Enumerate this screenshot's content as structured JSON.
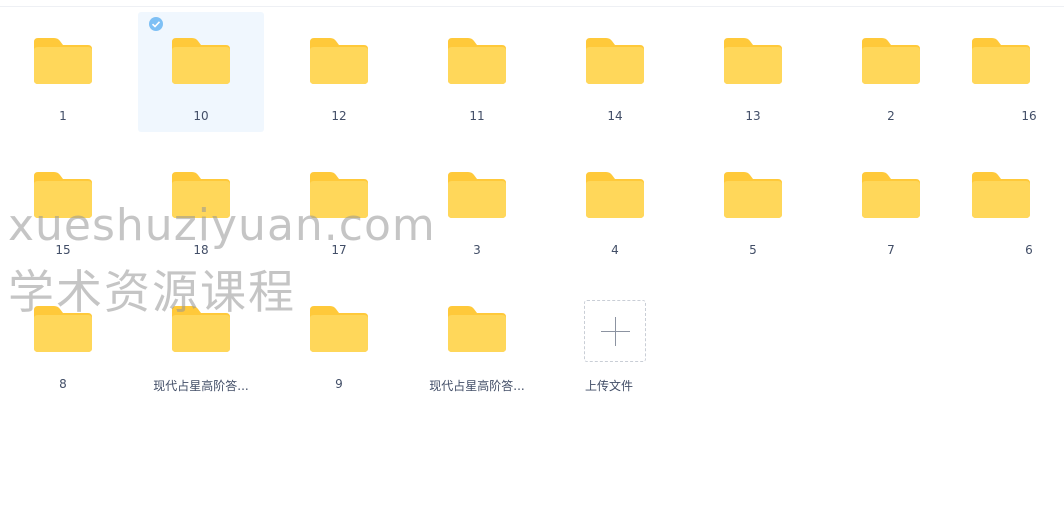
{
  "folders": [
    {
      "label": "1"
    },
    {
      "label": "10",
      "selected": true
    },
    {
      "label": "12"
    },
    {
      "label": "11"
    },
    {
      "label": "14"
    },
    {
      "label": "13"
    },
    {
      "label": "2"
    },
    {
      "label": "16"
    },
    {
      "label": "15"
    },
    {
      "label": "18"
    },
    {
      "label": "17"
    },
    {
      "label": "3"
    },
    {
      "label": "4"
    },
    {
      "label": "5"
    },
    {
      "label": "7"
    },
    {
      "label": "6"
    },
    {
      "label": "8"
    },
    {
      "label": "现代占星高阶答..."
    },
    {
      "label": "9"
    },
    {
      "label": "现代占星高阶答..."
    }
  ],
  "upload": {
    "label": "上传文件",
    "icon": "plus-icon"
  },
  "watermark": {
    "line1": "xueshuziyuan.com",
    "line2": "学术资源课程"
  },
  "colors": {
    "folder_body": "#ffd75a",
    "folder_back": "#ffc93a",
    "selected_bg": "#f0f7fe",
    "check": "#7ec0f5",
    "label": "#424e67"
  }
}
